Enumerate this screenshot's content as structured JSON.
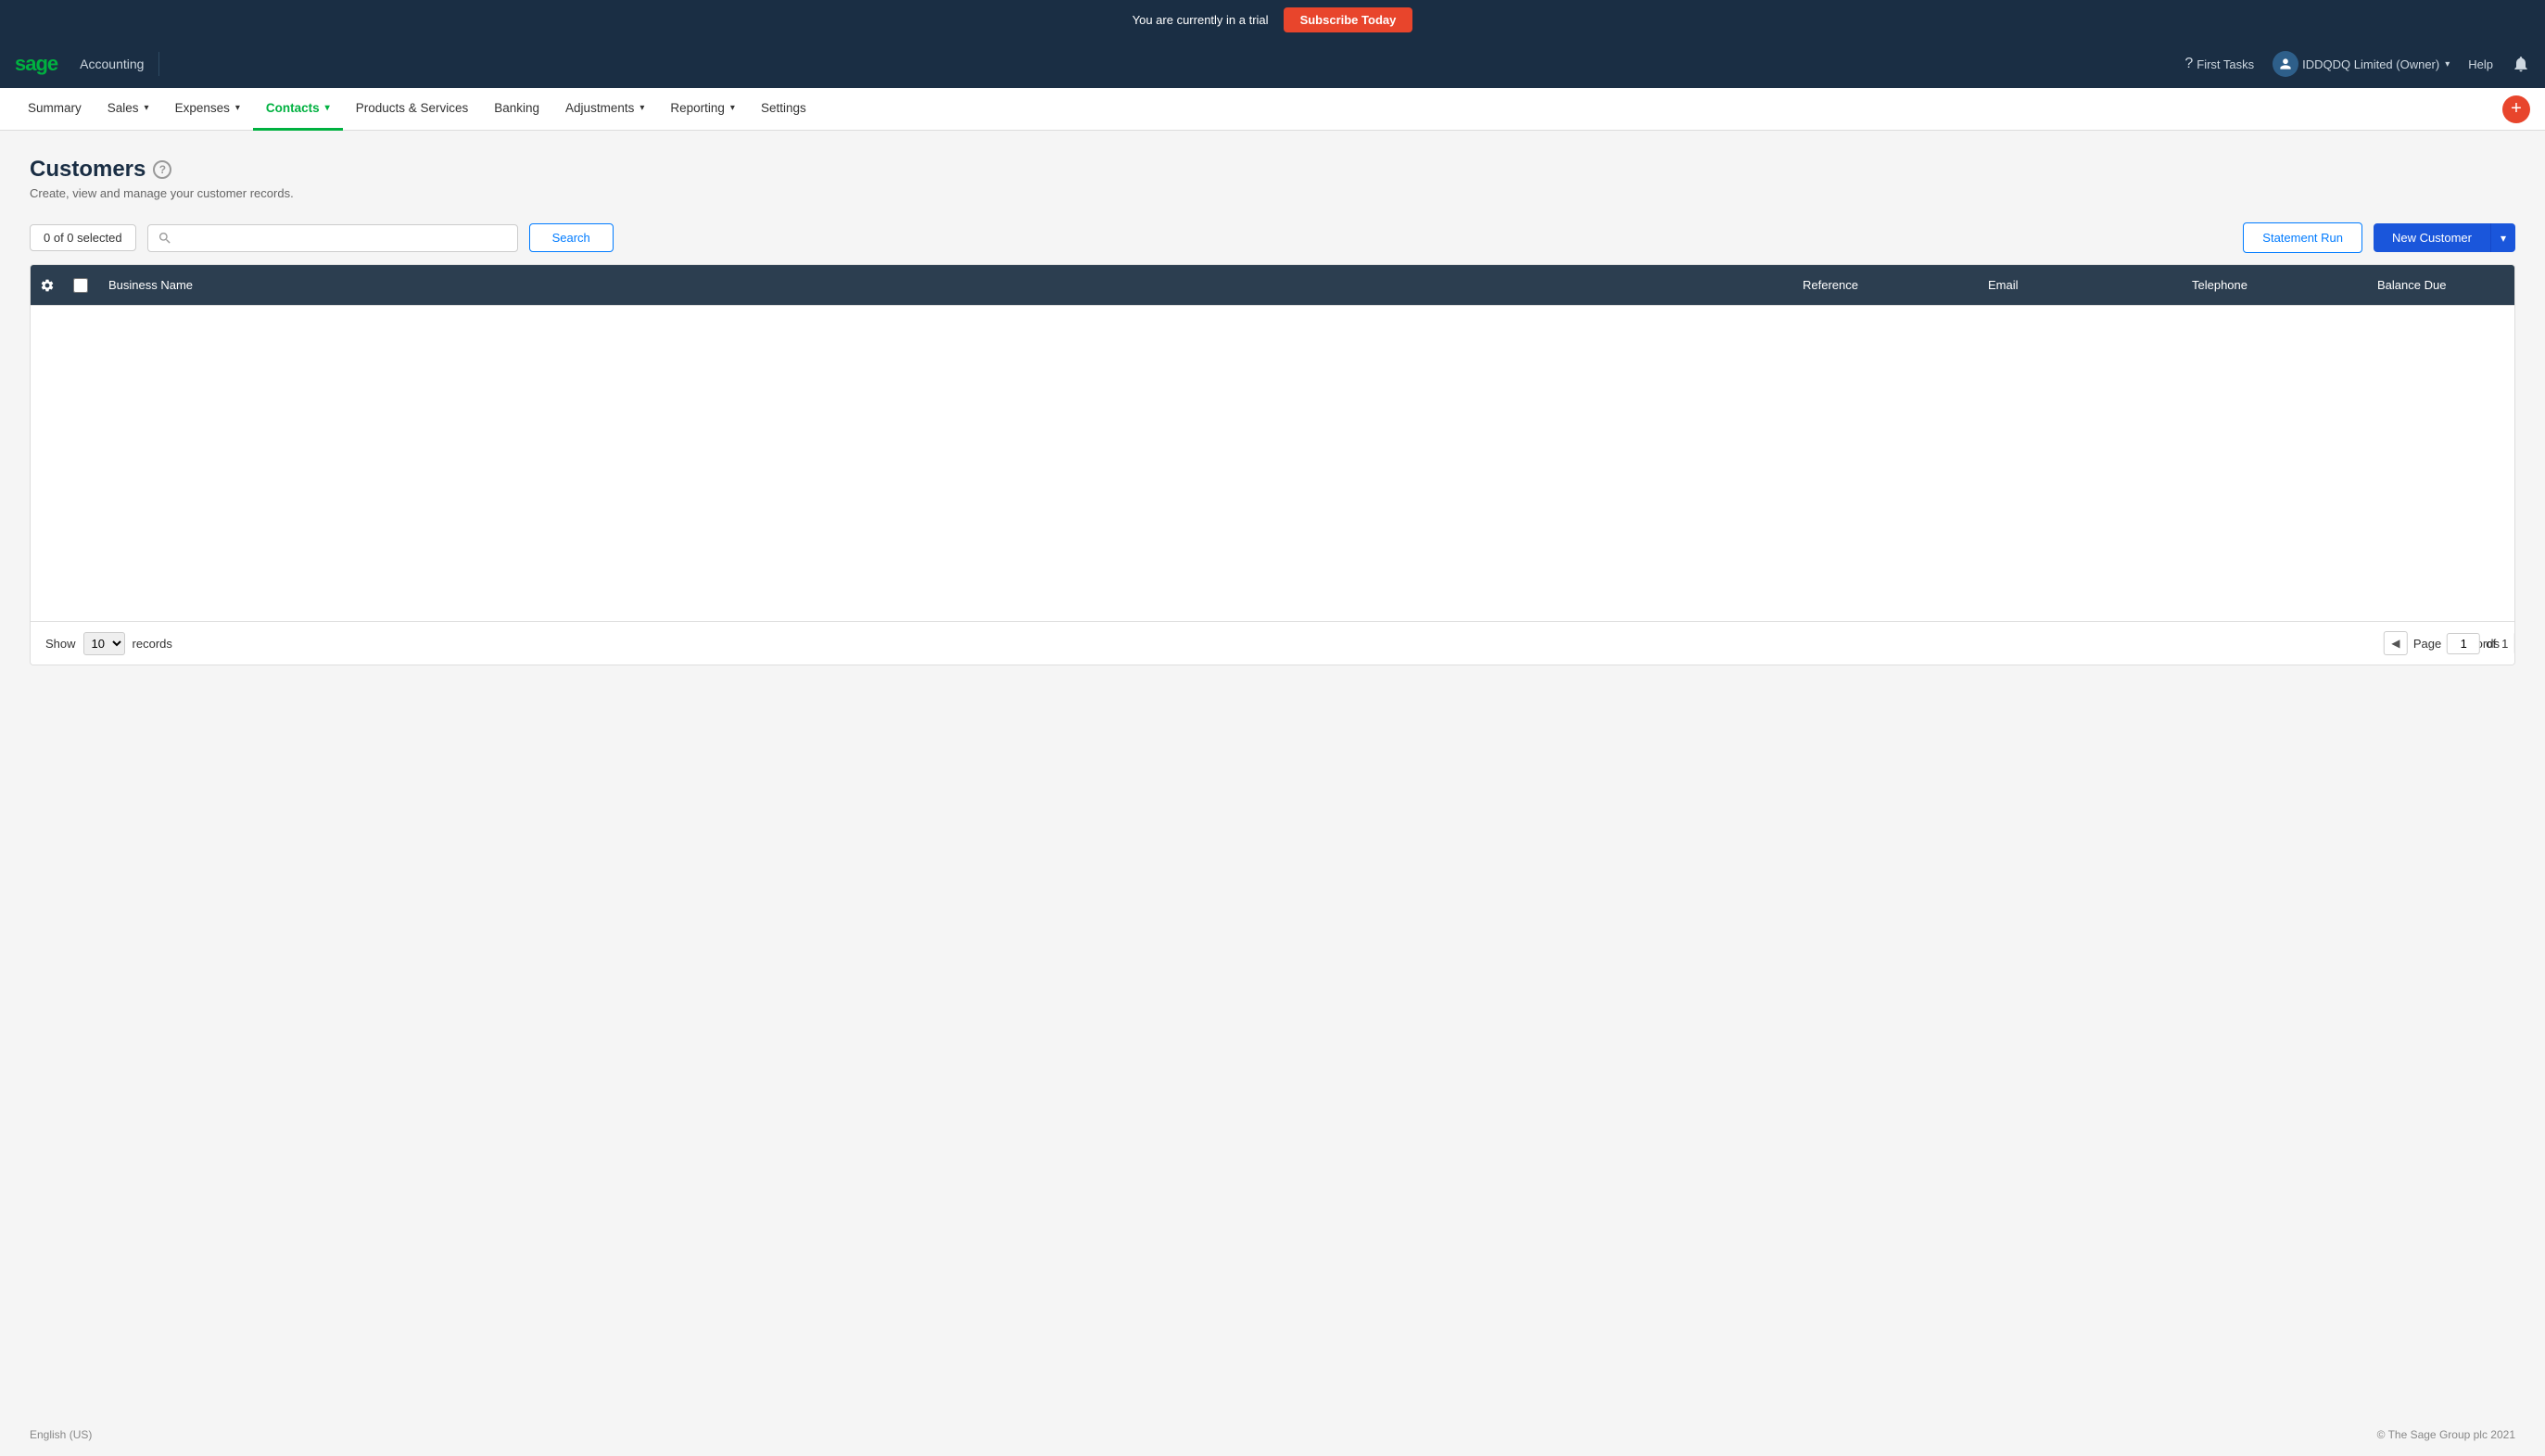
{
  "trial_banner": {
    "message": "You are currently in a trial",
    "subscribe_label": "Subscribe Today"
  },
  "top_nav": {
    "logo": "sage",
    "app_name": "Accounting",
    "first_tasks_label": "First Tasks",
    "user_name": "IDDQDQ Limited (Owner)",
    "help_label": "Help"
  },
  "main_nav": {
    "items": [
      {
        "label": "Summary",
        "active": false
      },
      {
        "label": "Sales",
        "dropdown": true,
        "active": false
      },
      {
        "label": "Expenses",
        "dropdown": true,
        "active": false
      },
      {
        "label": "Contacts",
        "dropdown": true,
        "active": true
      },
      {
        "label": "Products & Services",
        "dropdown": false,
        "active": false
      },
      {
        "label": "Banking",
        "dropdown": false,
        "active": false
      },
      {
        "label": "Adjustments",
        "dropdown": true,
        "active": false
      },
      {
        "label": "Reporting",
        "dropdown": true,
        "active": false
      },
      {
        "label": "Settings",
        "dropdown": false,
        "active": false
      }
    ],
    "plus_label": "+"
  },
  "page": {
    "title": "Customers",
    "subtitle": "Create, view and manage your customer records.",
    "selected_badge": "0 of 0 selected",
    "search_placeholder": "",
    "search_button": "Search",
    "statement_run_button": "Statement Run",
    "new_customer_button": "New Customer",
    "table_headers": {
      "business_name": "Business Name",
      "reference": "Reference",
      "email": "Email",
      "telephone": "Telephone",
      "balance_due": "Balance Due"
    },
    "pagination": {
      "show_label": "Show",
      "records_label": "records",
      "page_label": "Page",
      "current_page": "1",
      "total_pages": "1",
      "of_label": "of"
    },
    "records_count": "0 records"
  },
  "footer": {
    "language": "English (US)",
    "copyright": "© The Sage Group plc 2021"
  }
}
